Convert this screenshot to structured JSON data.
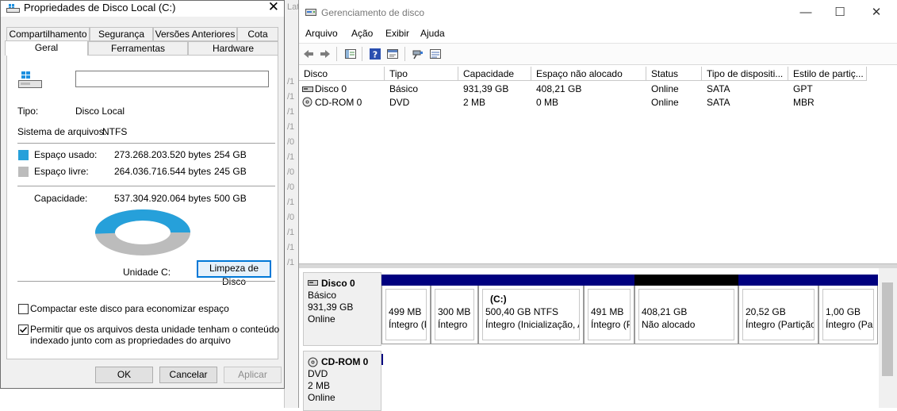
{
  "background_fragments": [
    "Lata",
    "/1",
    "/1",
    "/1",
    "/1",
    "/0",
    "/1",
    "/0",
    "/0",
    "/1",
    "/0",
    "/1",
    "/1",
    "/1"
  ],
  "properties": {
    "title": "Propriedades de Disco Local (C:)",
    "tabs_row1": [
      "Compartilhamento",
      "Segurança",
      "Versões Anteriores",
      "Cota"
    ],
    "tabs_row2": [
      "Geral",
      "Ferramentas",
      "Hardware"
    ],
    "selected_tab": "Geral",
    "name_input": "",
    "type_label": "Tipo:",
    "type_value": "Disco Local",
    "fs_label": "Sistema de arquivos:",
    "fs_value": "NTFS",
    "used_label": "Espaço usado:",
    "used_bytes": "273.268.203.520 bytes",
    "used_size": "254 GB",
    "free_label": "Espaço livre:",
    "free_bytes": "264.036.716.544 bytes",
    "free_size": "245 GB",
    "capacity_label": "Capacidade:",
    "capacity_bytes": "537.304.920.064 bytes",
    "capacity_size": "500 GB",
    "used_fraction": 0.5086,
    "drive_label": "Unidade C:",
    "cleanup_button": "Limpeza de Disco",
    "compress_label": "Compactar este disco para economizar espaço",
    "compress_checked": false,
    "index_label_line1": "Permitir que os arquivos desta unidade tenham o conteúdo",
    "index_label_line2": "indexado junto com as propriedades do arquivo",
    "index_checked": true,
    "ok_button": "OK",
    "cancel_button": "Cancelar",
    "apply_button": "Aplicar",
    "colors": {
      "used": "#26a0da",
      "free": "#bcbcbc"
    }
  },
  "disk_management": {
    "title": "Gerenciamento de disco",
    "menu": [
      "Arquivo",
      "Ação",
      "Exibir",
      "Ajuda"
    ],
    "toolbar_icons": [
      "back-arrow-icon",
      "forward-arrow-icon",
      "console-tree-icon",
      "help-icon",
      "properties-icon",
      "connect-icon",
      "list-view-icon"
    ],
    "columns": [
      "Disco",
      "Tipo",
      "Capacidade",
      "Espaço não alocado",
      "Status",
      "Tipo de dispositi...",
      "Estilo de partiç..."
    ],
    "rows": [
      [
        "Disco 0",
        "Básico",
        "931,39 GB",
        "408,21 GB",
        "Online",
        "SATA",
        "GPT"
      ],
      [
        "CD-ROM 0",
        "DVD",
        "2 MB",
        "0 MB",
        "Online",
        "SATA",
        "MBR"
      ]
    ],
    "disks": [
      {
        "name": "Disco 0",
        "type": "Básico",
        "size": "931,39 GB",
        "status": "Online"
      },
      {
        "name": "CD-ROM 0",
        "type": "DVD",
        "size": "2 MB",
        "status": "Online"
      }
    ],
    "partitions": [
      {
        "title": "",
        "line1": "499 MB",
        "line2": "Íntegro (P",
        "bar": "#00007f"
      },
      {
        "title": "",
        "line1": "300 MB",
        "line2": "Íntegro",
        "bar": "#00007f"
      },
      {
        "title": "(C:)",
        "line1": "500,40 GB NTFS",
        "line2": "Íntegro (Inicialização, A",
        "bar": "#00007f"
      },
      {
        "title": "",
        "line1": "491 MB",
        "line2": "Íntegro (P",
        "bar": "#00007f"
      },
      {
        "title": "",
        "line1": "408,21 GB",
        "line2": "Não alocado",
        "bar": "#000000"
      },
      {
        "title": "",
        "line1": "20,52 GB",
        "line2": "Íntegro (Partição",
        "bar": "#00007f"
      },
      {
        "title": "",
        "line1": "1,00 GB",
        "line2": "Íntegro (Pa",
        "bar": "#00007f"
      }
    ]
  }
}
